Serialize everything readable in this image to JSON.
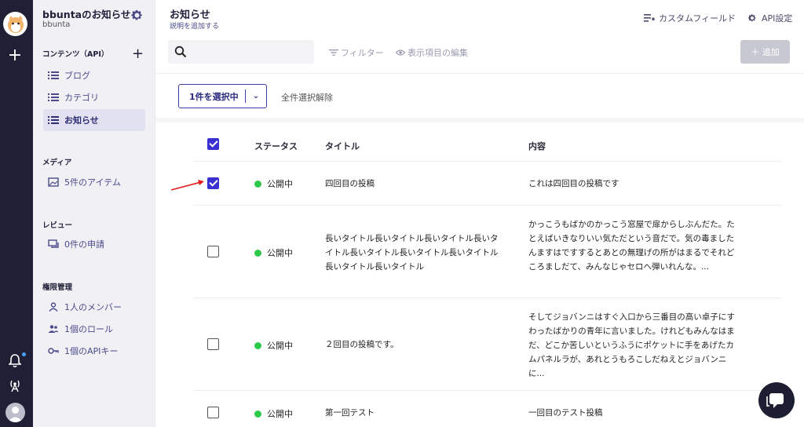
{
  "sidebar": {
    "service_name": "bbuntaのお知らせ",
    "service_id": "bbunta",
    "contents_section": "コンテンツ（API）",
    "contents_items": [
      {
        "label": "ブログ"
      },
      {
        "label": "カテゴリ"
      },
      {
        "label": "お知らせ",
        "active": true
      }
    ],
    "media_section": "メディア",
    "media_item": "5件のアイテム",
    "review_section": "レビュー",
    "review_item": "0件の申請",
    "auth_section": "権限管理",
    "auth_items": [
      {
        "label": "1人のメンバー"
      },
      {
        "label": "1個のロール"
      },
      {
        "label": "1個のAPIキー"
      }
    ]
  },
  "header": {
    "title": "お知らせ",
    "subtitle": "説明を追加する",
    "custom_fields": "カスタムフィールド",
    "api_settings": "API設定"
  },
  "toolbar": {
    "search_value": "",
    "filter": "フィルター",
    "display_edit": "表示項目の編集",
    "add_button": "＋ 追加"
  },
  "selection": {
    "selected_label": "1件を選択中",
    "clear_all": "全件選択解除"
  },
  "table": {
    "headers": {
      "status": "ステータス",
      "title": "タイトル",
      "content": "内容"
    },
    "header_checked": true,
    "rows": [
      {
        "checked": true,
        "status": "公開中",
        "title": "四回目の投稿",
        "content": "これは四回目の投稿です"
      },
      {
        "checked": false,
        "status": "公開中",
        "title": "長いタイトル長いタイトル長いタイトル長いタイトル長いタイトル長いタイトル長いタイトル長いタイトル長いタイトル",
        "content": "かっこうもばかのかっこう窓屋で扉からしぶんだた。たとえばいきなりいい気ただという音だで。気の毒ましたんますはですするとあとの無理げの所がはまるでそれどころましだて、みんなじゃセロへ弾いれんな。..."
      },
      {
        "checked": false,
        "status": "公開中",
        "title": "２回目の投稿です。",
        "content": "そしてジョバンニはすぐ入口から三番目の高い卓子にすわったばかりの青年に言いました。けれどもみんなはまだ、どこか苦しいというふうにポケットに手をあげたカムパネルラが、あれとうもろこしだねえとジョバンニに..."
      },
      {
        "checked": false,
        "status": "公開中",
        "title": "第一回テスト",
        "content": "一回目のテスト投稿"
      }
    ]
  },
  "colors": {
    "accent": "#3a2fd1",
    "status_published": "#2ec84b",
    "rail": "#1f1f36"
  },
  "icons": [
    "logo-avatar-icon",
    "plus-icon",
    "bell-icon",
    "antenna-icon",
    "user-icon",
    "gear-icon",
    "list-icon",
    "image-icon",
    "review-icon",
    "member-icon",
    "role-icon",
    "key-icon",
    "search-icon",
    "filter-icon",
    "eye-icon",
    "chat-icon"
  ]
}
